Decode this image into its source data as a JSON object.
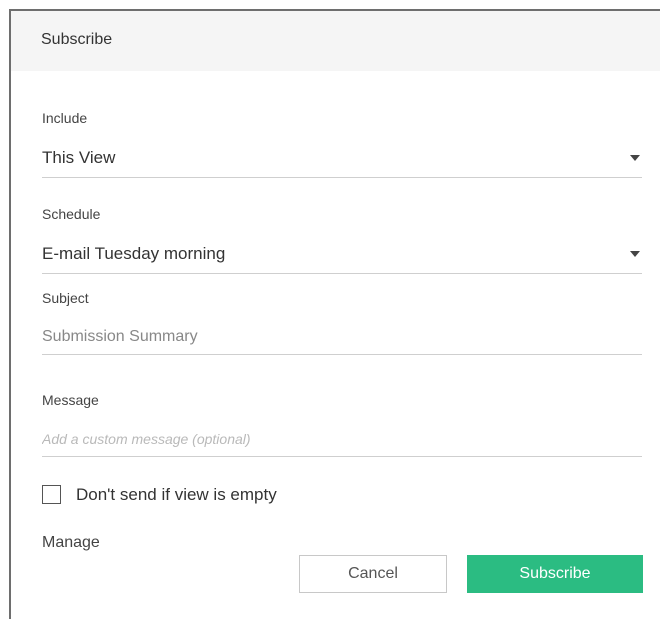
{
  "dialog": {
    "title": "Subscribe"
  },
  "include": {
    "label": "Include",
    "value": "This View"
  },
  "schedule": {
    "label": "Schedule",
    "value": "E-mail Tuesday morning"
  },
  "subject": {
    "label": "Subject",
    "value": "Submission Summary"
  },
  "message": {
    "label": "Message",
    "placeholder": "Add a custom message (optional)"
  },
  "empty_check": {
    "label": "Don't send if view is empty",
    "checked": false
  },
  "manage": {
    "label": "Manage"
  },
  "buttons": {
    "cancel": "Cancel",
    "subscribe": "Subscribe"
  },
  "colors": {
    "accent": "#2bbc82",
    "header_bg": "#f5f5f5"
  }
}
